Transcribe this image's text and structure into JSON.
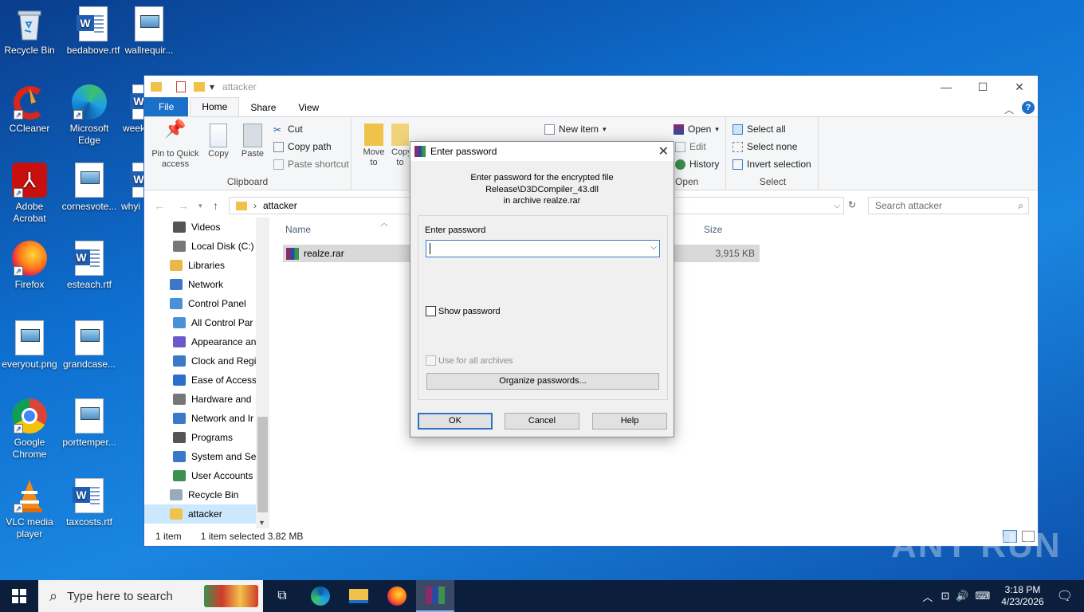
{
  "desktop": {
    "icons": [
      {
        "label": "Recycle Bin"
      },
      {
        "label": "bedabove.rtf"
      },
      {
        "label": "wallrequir..."
      },
      {
        "label": "CCleaner"
      },
      {
        "label": "Microsoft Edge"
      },
      {
        "label": "week"
      },
      {
        "label": "Adobe Acrobat"
      },
      {
        "label": "cornesvote..."
      },
      {
        "label": "whyi"
      },
      {
        "label": "Firefox"
      },
      {
        "label": "esteach.rtf"
      },
      {
        "label": "everyout.png"
      },
      {
        "label": "grandcase..."
      },
      {
        "label": "Google Chrome"
      },
      {
        "label": "porttemper..."
      },
      {
        "label": "VLC media player"
      },
      {
        "label": "taxcosts.rtf"
      }
    ]
  },
  "explorer": {
    "title": "attacker",
    "tabs": {
      "file": "File",
      "home": "Home",
      "share": "Share",
      "view": "View"
    },
    "ribbon": {
      "pin": "Pin to Quick access",
      "copy": "Copy",
      "paste": "Paste",
      "cut": "Cut",
      "copy_path": "Copy path",
      "paste_shortcut": "Paste shortcut",
      "clipboard": "Clipboard",
      "move_to": "Move to",
      "copy_to": "Copy to",
      "new_item": "New item",
      "open": "Open",
      "edit": "Edit",
      "history": "History",
      "open_group": "Open",
      "select_all": "Select all",
      "select_none": "Select none",
      "invert": "Invert selection",
      "select_group": "Select"
    },
    "address": "attacker",
    "search_placeholder": "Search attacker",
    "nav": [
      {
        "label": "Videos",
        "color": "#555"
      },
      {
        "label": "Local Disk (C:)",
        "color": "#777"
      },
      {
        "label": "Libraries",
        "color": "#e8b84a"
      },
      {
        "label": "Network",
        "color": "#3c78c8"
      },
      {
        "label": "Control Panel",
        "color": "#4a90d9"
      },
      {
        "label": "All Control Par",
        "color": "#4a90d9"
      },
      {
        "label": "Appearance an",
        "color": "#6a5acd"
      },
      {
        "label": "Clock and Regi",
        "color": "#3c78c8"
      },
      {
        "label": "Ease of Access",
        "color": "#2a6fc9"
      },
      {
        "label": "Hardware and",
        "color": "#777"
      },
      {
        "label": "Network and Ir",
        "color": "#3c78c8"
      },
      {
        "label": "Programs",
        "color": "#555"
      },
      {
        "label": "System and Se",
        "color": "#3c78c8"
      },
      {
        "label": "User Accounts",
        "color": "#3c9050"
      },
      {
        "label": "Recycle Bin",
        "color": "#9ab"
      },
      {
        "label": "attacker",
        "color": "#f0c24a"
      }
    ],
    "columns": {
      "name": "Name",
      "size": "Size"
    },
    "file": {
      "name": "realze.rar",
      "size": "3,915 KB"
    },
    "status": {
      "count": "1 item",
      "selected": "1 item selected  3.82 MB"
    }
  },
  "dialog": {
    "title": "Enter password",
    "message_line1": "Enter password for the encrypted file",
    "message_line2": "Release\\D3DCompiler_43.dll",
    "message_line3": "in archive realze.rar",
    "label": "Enter password",
    "show_password": "Show password",
    "use_all": "Use for all archives",
    "organize": "Organize passwords...",
    "ok": "OK",
    "cancel": "Cancel",
    "help": "Help"
  },
  "taskbar": {
    "search_placeholder": "Type here to search",
    "time": "3:18 PM",
    "date": "4/23/2026"
  },
  "watermark": "ANY RUN"
}
